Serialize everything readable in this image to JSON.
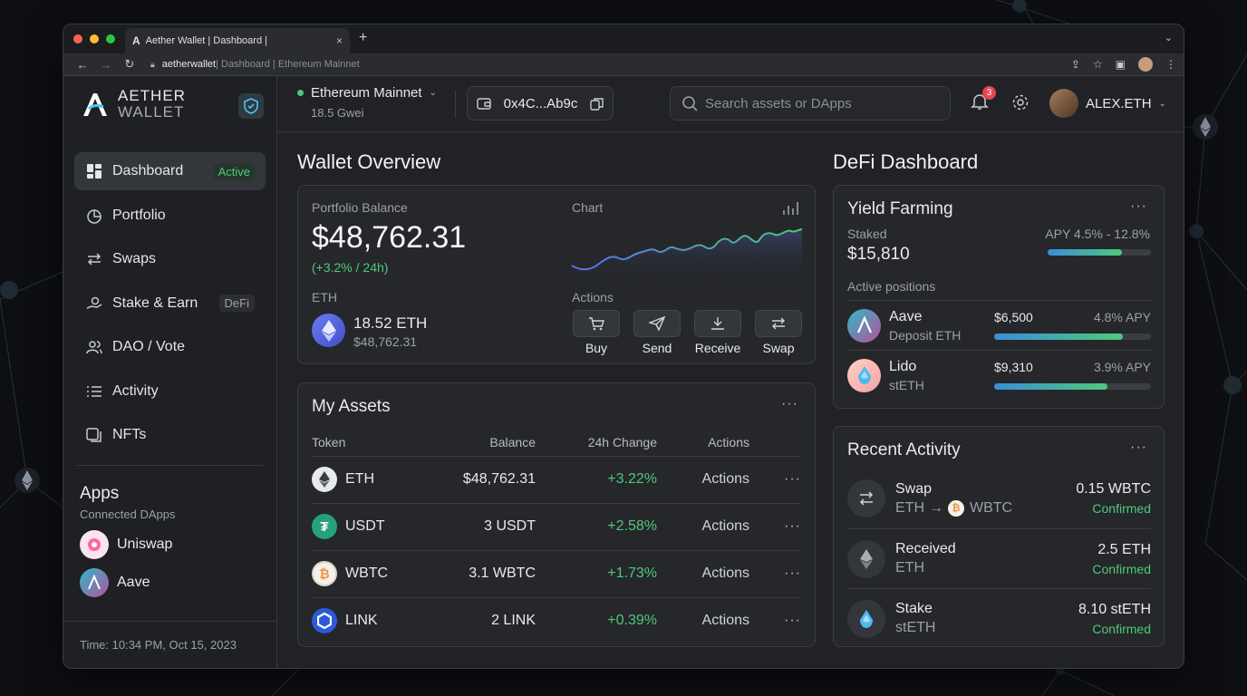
{
  "browser": {
    "tab_title": "Aether Wallet | Dashboard |",
    "tab_favicon": "A",
    "tab_close": "×",
    "new_tab": "+",
    "url_host": "aetherwallet",
    "url_path": " | Dashboard | Ethereum Mainnet"
  },
  "brand": {
    "line1": "AETHER",
    "line2": "WALLET"
  },
  "sidebar": {
    "items": [
      {
        "label": "Dashboard",
        "badge": "Active"
      },
      {
        "label": "Portfolio"
      },
      {
        "label": "Swaps"
      },
      {
        "label": "Stake & Earn",
        "badge": "DeFi"
      },
      {
        "label": "DAO / Vote"
      },
      {
        "label": "Activity"
      },
      {
        "label": "NFTs"
      }
    ],
    "apps_title": "Apps",
    "apps_subtitle": "Connected DApps",
    "apps": [
      {
        "name": "Uniswap"
      },
      {
        "name": "Aave"
      }
    ],
    "footer_time": "Time: 10:34 PM, Oct 15, 2023"
  },
  "topbar": {
    "network": "Ethereum Mainnet",
    "gas": "18.5 Gwei",
    "address": "0x4C...Ab9c",
    "search_placeholder": "Search assets or DApps",
    "notif_count": "3",
    "username": "ALEX.ETH"
  },
  "overview": {
    "title": "Wallet Overview",
    "balance_label": "Portfolio Balance",
    "balance": "$48,762.31",
    "change": "(+3.2% / 24h)",
    "eth_label": "ETH",
    "eth_amount": "18.52 ETH",
    "eth_value": "$48,762.31",
    "chart_label": "Chart",
    "actions_label": "Actions",
    "actions": [
      {
        "label": "Buy"
      },
      {
        "label": "Send"
      },
      {
        "label": "Receive"
      },
      {
        "label": "Swap"
      }
    ]
  },
  "assets": {
    "title": "My Assets",
    "columns": [
      "Token",
      "Balance",
      "24h Change",
      "Actions"
    ],
    "rows": [
      {
        "token": "ETH",
        "balance": "$48,762.31",
        "change": "+3.22%",
        "action": "Actions"
      },
      {
        "token": "USDT",
        "balance": "3 USDT",
        "change": "+2.58%",
        "action": "Actions"
      },
      {
        "token": "WBTC",
        "balance": "3.1 WBTC",
        "change": "+1.73%",
        "action": "Actions"
      },
      {
        "token": "LINK",
        "balance": "2 LINK",
        "change": "+0.39%",
        "action": "Actions"
      }
    ]
  },
  "defi": {
    "title": "DeFi Dashboard",
    "yield_title": "Yield Farming",
    "staked_label": "Staked",
    "staked_value": "$15,810",
    "apy_range": "APY 4.5% - 12.8%",
    "apy_progress": 0.72,
    "positions_label": "Active positions",
    "positions": [
      {
        "name": "Aave",
        "sub": "Deposit ETH",
        "amount": "$6,500",
        "apy": "4.8% APY",
        "progress": 0.82
      },
      {
        "name": "Lido",
        "sub": "stETH",
        "amount": "$9,310",
        "apy": "3.9% APY",
        "progress": 0.72
      }
    ]
  },
  "activity": {
    "title": "Recent Activity",
    "items": [
      {
        "title": "Swap",
        "from": "ETH",
        "arrow": "→",
        "to": "WBTC",
        "amount": "0.15 WBTC",
        "status": "Confirmed"
      },
      {
        "title": "Received",
        "sub": "ETH",
        "amount": "2.5 ETH",
        "status": "Confirmed"
      },
      {
        "title": "Stake",
        "sub": "stETH",
        "amount": "8.10 stETH",
        "status": "Confirmed"
      }
    ]
  },
  "colors": {
    "accent_green": "#4ec97a",
    "background": "#0d0f12",
    "card": "#25272b",
    "notif_red": "#e5484d"
  },
  "icons": [
    "back-icon",
    "forward-icon",
    "reload-icon",
    "lock-icon",
    "share-icon",
    "star-icon",
    "sidebar-toggle-icon",
    "menu-icon",
    "shield-icon",
    "dashboard-icon",
    "pie-chart-icon",
    "swap-icon",
    "stake-icon",
    "people-icon",
    "list-icon",
    "nft-icon",
    "wallet-icon",
    "copy-icon",
    "search-icon",
    "bell-icon",
    "gear-icon",
    "cart-icon",
    "send-icon",
    "download-icon",
    "kebab-icon"
  ]
}
